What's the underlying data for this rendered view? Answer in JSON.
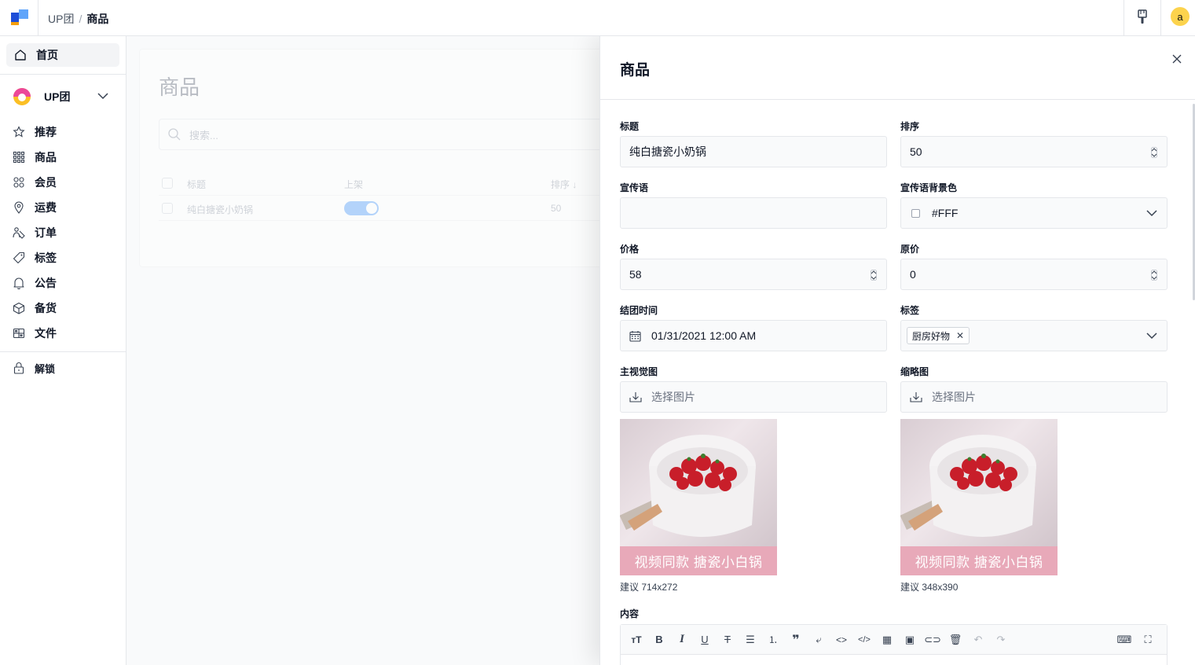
{
  "topbar": {
    "breadcrumb": [
      "UP团",
      "商品"
    ],
    "avatar_letter": "a"
  },
  "sidebar": {
    "home": "首页",
    "team_name": "UP团",
    "items": [
      {
        "label": "推荐",
        "icon": "star-icon"
      },
      {
        "label": "商品",
        "icon": "grid-icon"
      },
      {
        "label": "会员",
        "icon": "members-icon"
      },
      {
        "label": "运费",
        "icon": "location-pin-icon"
      },
      {
        "label": "订单",
        "icon": "orders-icon"
      },
      {
        "label": "标签",
        "icon": "tag-icon"
      },
      {
        "label": "公告",
        "icon": "bell-icon"
      },
      {
        "label": "备货",
        "icon": "box-icon"
      },
      {
        "label": "文件",
        "icon": "file-grid-icon"
      }
    ],
    "unlock": "解锁"
  },
  "main": {
    "title": "商品",
    "search_placeholder": "搜索...",
    "columns": [
      "标题",
      "上架",
      "排序"
    ],
    "rows": [
      {
        "title": "纯白搪瓷小奶锅",
        "sort": "50"
      }
    ]
  },
  "drawer": {
    "title": "商品",
    "labels": {
      "title": "标题",
      "sort": "排序",
      "slogan": "宣传语",
      "slogan_bg": "宣传语背景色",
      "price": "价格",
      "orig_price": "原价",
      "deadline": "结团时间",
      "tags": "标签",
      "main_visual": "主视觉图",
      "thumbnail": "缩略图",
      "content": "内容"
    },
    "values": {
      "title": "纯白搪瓷小奶锅",
      "sort": "50",
      "slogan": "",
      "slogan_bg": "#FFF",
      "price": "58",
      "orig_price": "0",
      "deadline": "01/31/2021 12:00 AM",
      "tag": "厨房好物"
    },
    "pick_image": "选择图片",
    "image_banner": "视频同款  搪瓷小白锅",
    "hint_main": "建议 714x272",
    "hint_thumb": "建议 348x390"
  },
  "colors": {
    "banner": "#e8a9b9",
    "toggle": "#60a5fa",
    "avatar": "#fcd34d"
  }
}
